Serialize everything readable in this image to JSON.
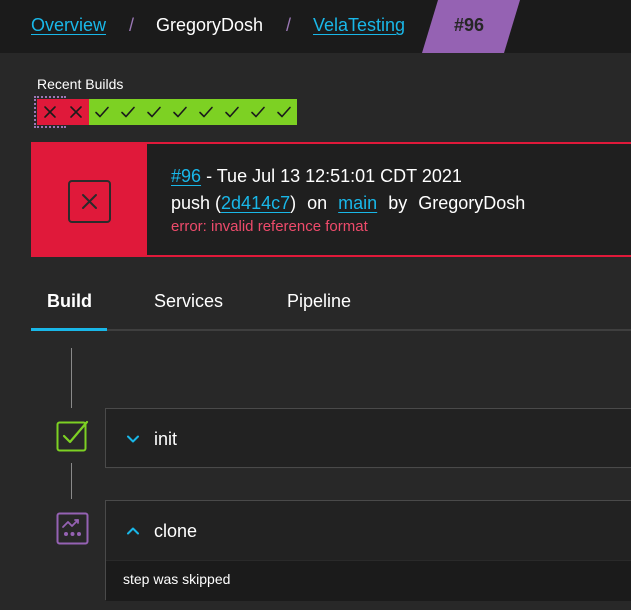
{
  "breadcrumb": {
    "overview": "Overview",
    "org": "GregoryDosh",
    "repo": "VelaTesting",
    "current": "#96",
    "separator": "/"
  },
  "recent_builds": {
    "label": "Recent Builds",
    "statuses": [
      "failure",
      "failure",
      "success",
      "success",
      "success",
      "success",
      "success",
      "success",
      "success",
      "success"
    ]
  },
  "build": {
    "status": "failure",
    "number": "#96",
    "date": "- Tue Jul 13 12:51:01 CDT 2021",
    "event": "push (",
    "commit": "2d414c7",
    "close_paren": ")",
    "on": "on",
    "branch": "main",
    "by": "by",
    "author": "GregoryDosh",
    "error": "error: invalid reference format"
  },
  "tabs": [
    {
      "label": "Build",
      "active": true
    },
    {
      "label": "Services",
      "active": false
    },
    {
      "label": "Pipeline",
      "active": false
    }
  ],
  "steps": [
    {
      "name": "init",
      "status": "success",
      "expanded": false
    },
    {
      "name": "clone",
      "status": "skipped",
      "expanded": true,
      "message": "step was skipped"
    }
  ],
  "colors": {
    "failure": "#e0193a",
    "success": "#7dd123",
    "link": "#19b7e8",
    "accent": "#9562b3",
    "error_text": "#ee4b6b"
  }
}
